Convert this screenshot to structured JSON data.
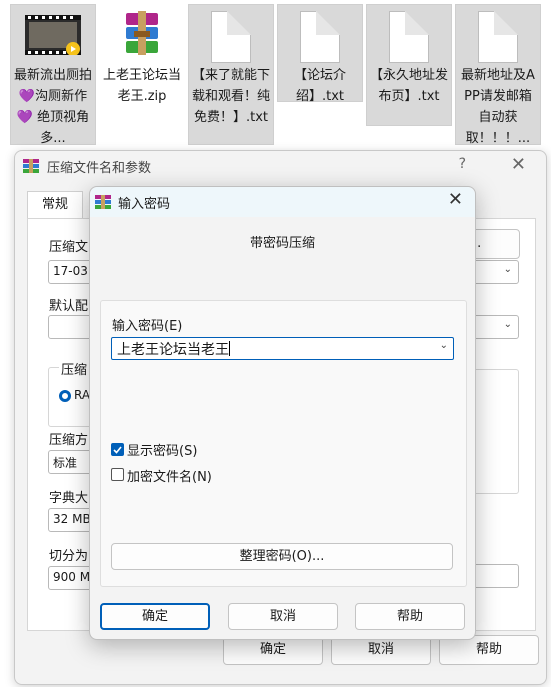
{
  "desktop": {
    "files": [
      {
        "name": "最新流出厕拍💜沟厕新作💜 绝顶视角 多...",
        "icon": "video-thumbnail-icon"
      },
      {
        "name": "上老王论坛当老王.zip",
        "icon": "winrar-archive-icon"
      },
      {
        "name": "【来了就能下载和观看！纯免费！】.txt",
        "icon": "text-file-icon"
      },
      {
        "name": "【论坛介绍】.txt",
        "icon": "text-file-icon"
      },
      {
        "name": "【永久地址发布页】.txt",
        "icon": "text-file-icon"
      },
      {
        "name": "最新地址及APP请发邮箱自动获取！！！...",
        "icon": "text-file-icon"
      }
    ]
  },
  "archive_window": {
    "title": "压缩文件名和参数",
    "help": "?",
    "close": "✕",
    "tabs": [
      "常规"
    ],
    "archive_name_label": "压缩文",
    "browse_button": "(B)...",
    "archive_name_value": "17-03",
    "default_profile_label": "默认配",
    "format_group_label": "压缩",
    "format_radio_label": "RA",
    "method_label": "压缩方",
    "method_value": "标准",
    "dict_label": "字典大",
    "dict_value": "32 MB",
    "split_label": "切分为",
    "split_value": "900 MI",
    "buttons": {
      "ok": "确定",
      "cancel": "取消",
      "help": "帮助"
    }
  },
  "password_dialog": {
    "title": "输入密码",
    "close": "✕",
    "heading": "带密码压缩",
    "password_label": "输入密码(E)",
    "password_value": "上老王论坛当老王",
    "show_password_label": "显示密码(S)",
    "show_password_checked": true,
    "encrypt_names_label": "加密文件名(N)",
    "encrypt_names_checked": false,
    "organize_button": "整理密码(O)...",
    "buttons": {
      "ok": "确定",
      "cancel": "取消",
      "help": "帮助"
    }
  },
  "colors": {
    "accent": "#005fb8",
    "dialog_title_bg": "#eef7fb",
    "tile_selected_bg": "#d9d9d9"
  }
}
